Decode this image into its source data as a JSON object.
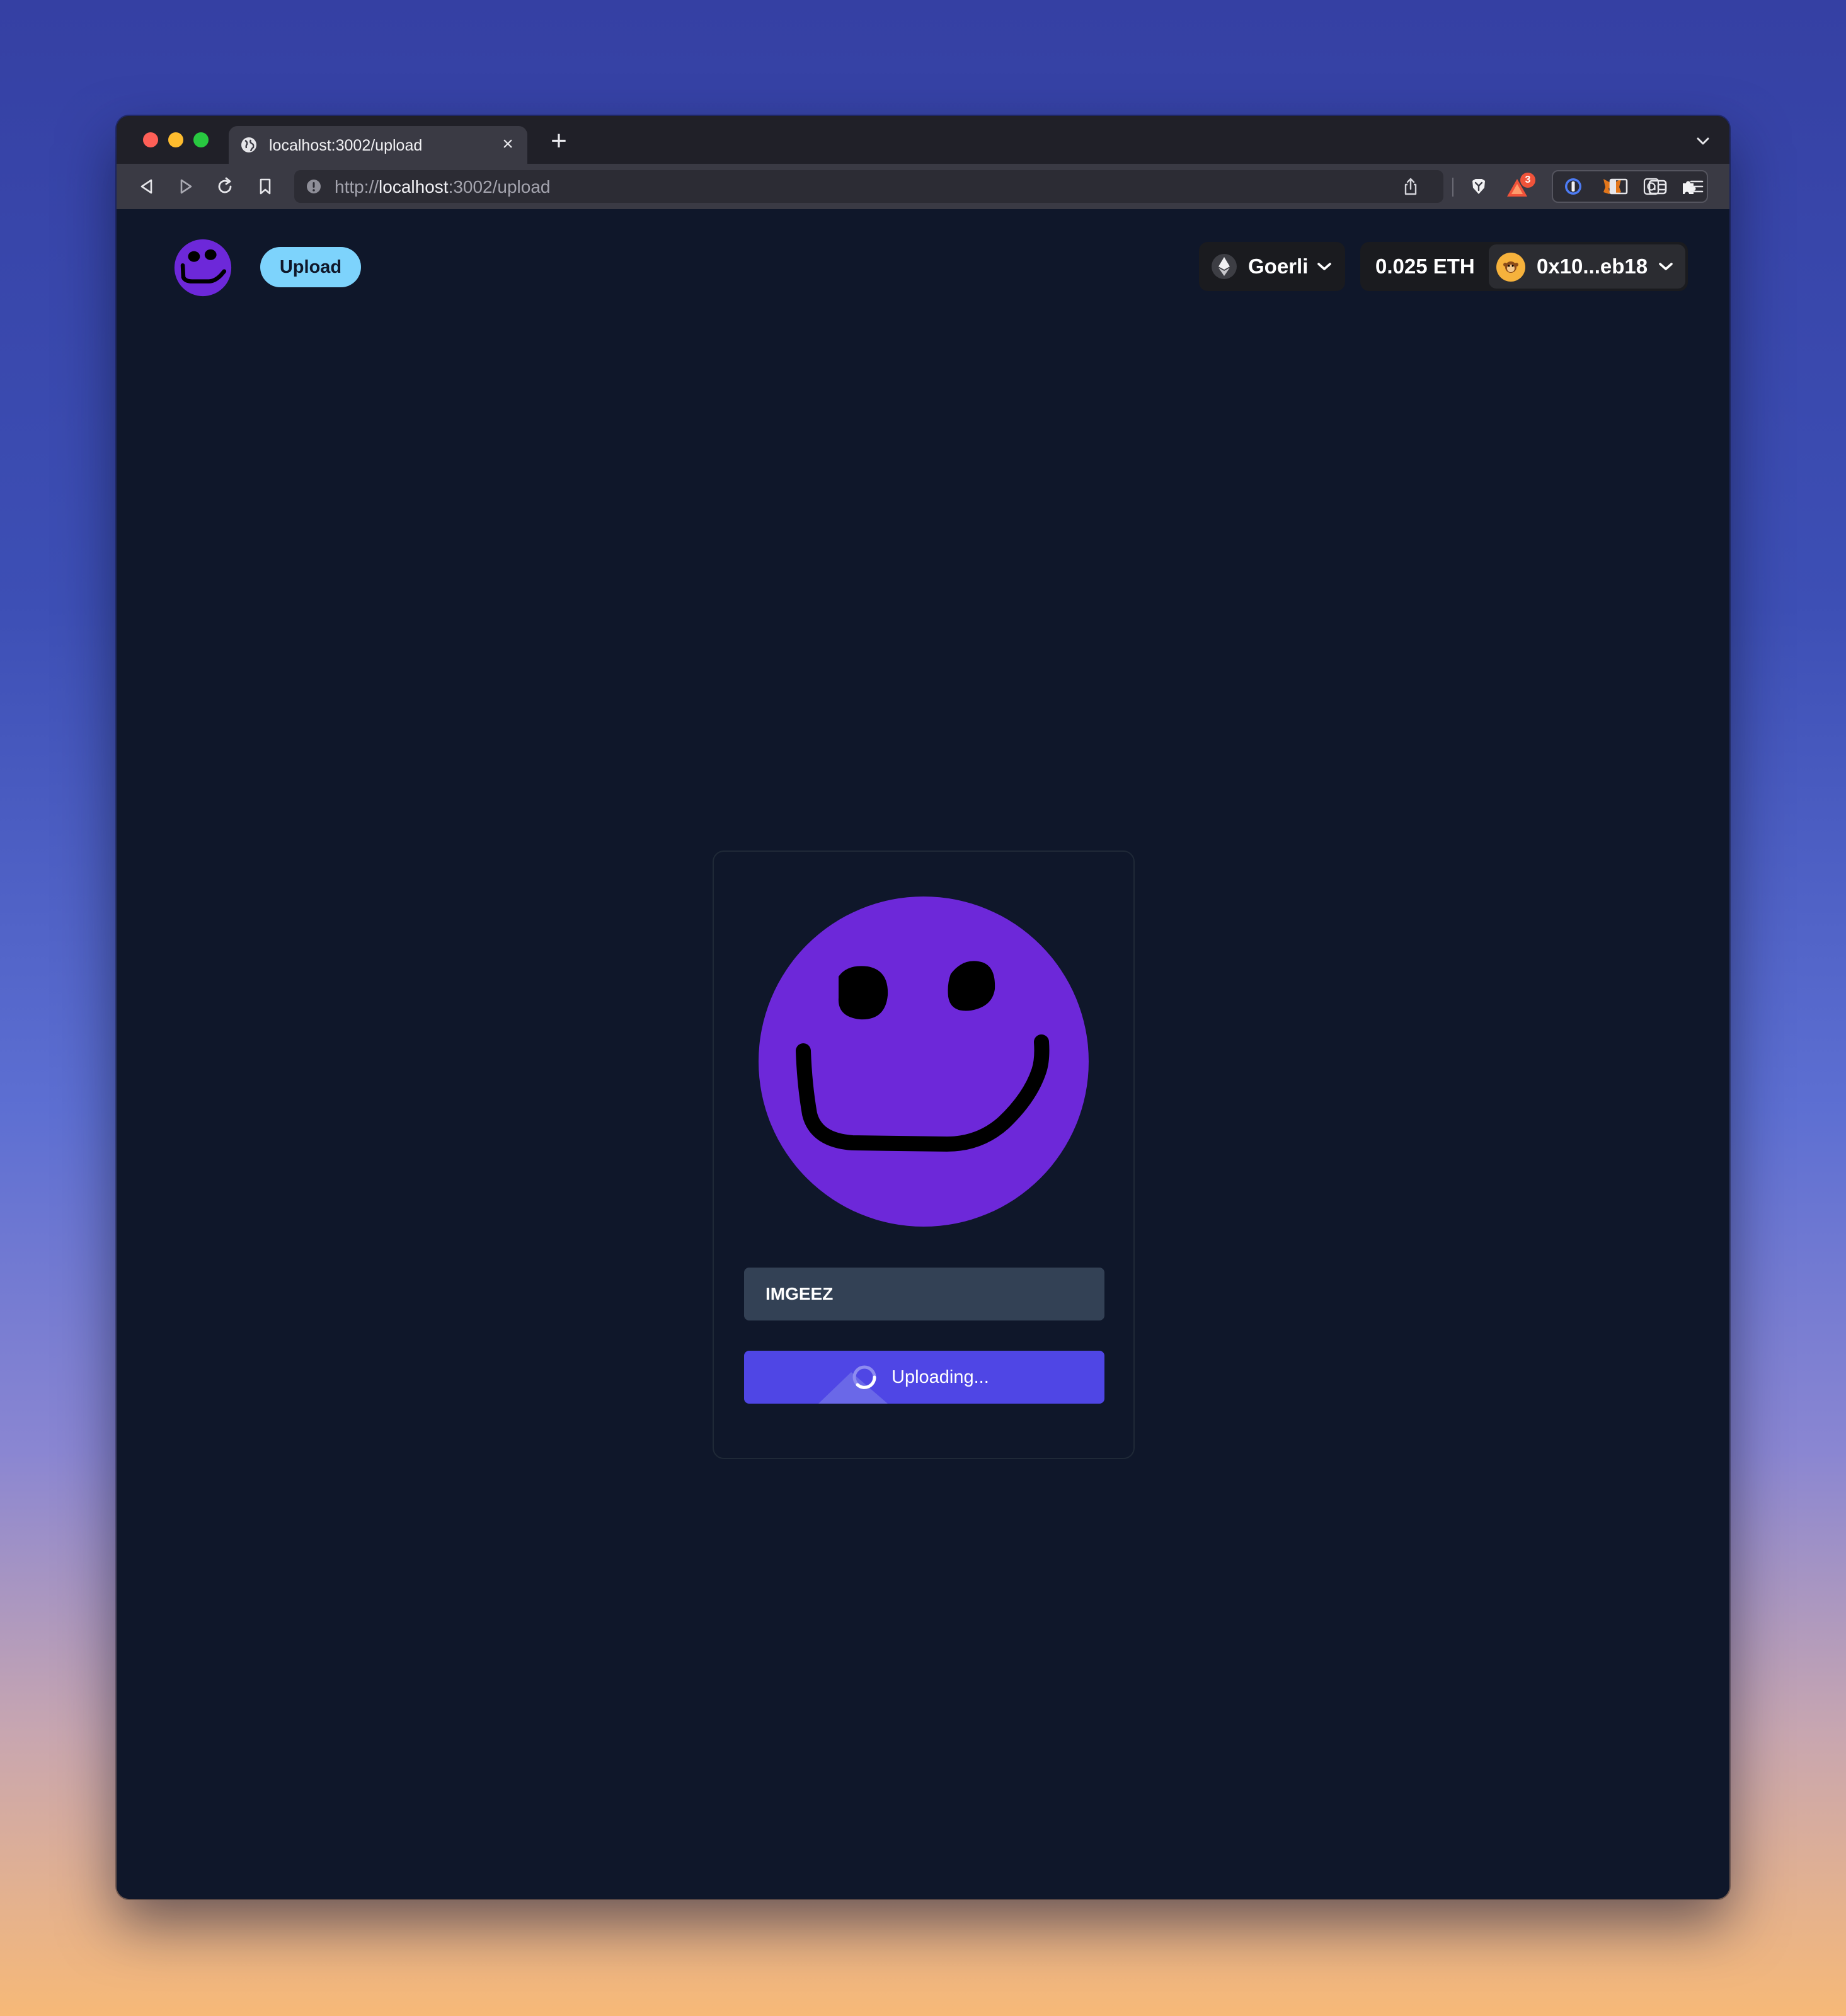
{
  "browser": {
    "tab": {
      "title": "localhost:3002/upload",
      "close_glyph": "×",
      "icon": "globe-icon"
    },
    "new_tab_glyph": "+",
    "url": {
      "scheme": "http://",
      "host": "localhost",
      "path": ":3002/upload"
    },
    "brave_rewards_badge": "3",
    "toolbar_icons": [
      "back-icon",
      "forward-icon",
      "reload-icon",
      "bookmark-icon",
      "info-icon",
      "share-icon",
      "brave-shields-icon",
      "brave-rewards-icon",
      "password-manager-icon",
      "metamask-icon",
      "extension-icon",
      "puzzle-icon",
      "sidebar-icon",
      "wallet-icon",
      "menu-icon"
    ]
  },
  "header": {
    "logo_icon": "smiley-logo-icon",
    "upload_label": "Upload",
    "network": {
      "name": "Goerli",
      "icon": "ethereum-icon"
    },
    "balance": "0.025 ETH",
    "address": "0x10...eb18",
    "avatar_icon": "monkey-avatar-icon"
  },
  "upload_card": {
    "preview_icon": "smiley-drawing",
    "name_value": "IMGEEZ",
    "button_label": "Uploading...",
    "button_state": "loading"
  },
  "colors": {
    "page_bg": "#0f172a",
    "accent": "#4f46e5",
    "nav_pill": "#7dd3fc",
    "smiley": "#6d28d9",
    "input_bg": "#334155"
  }
}
